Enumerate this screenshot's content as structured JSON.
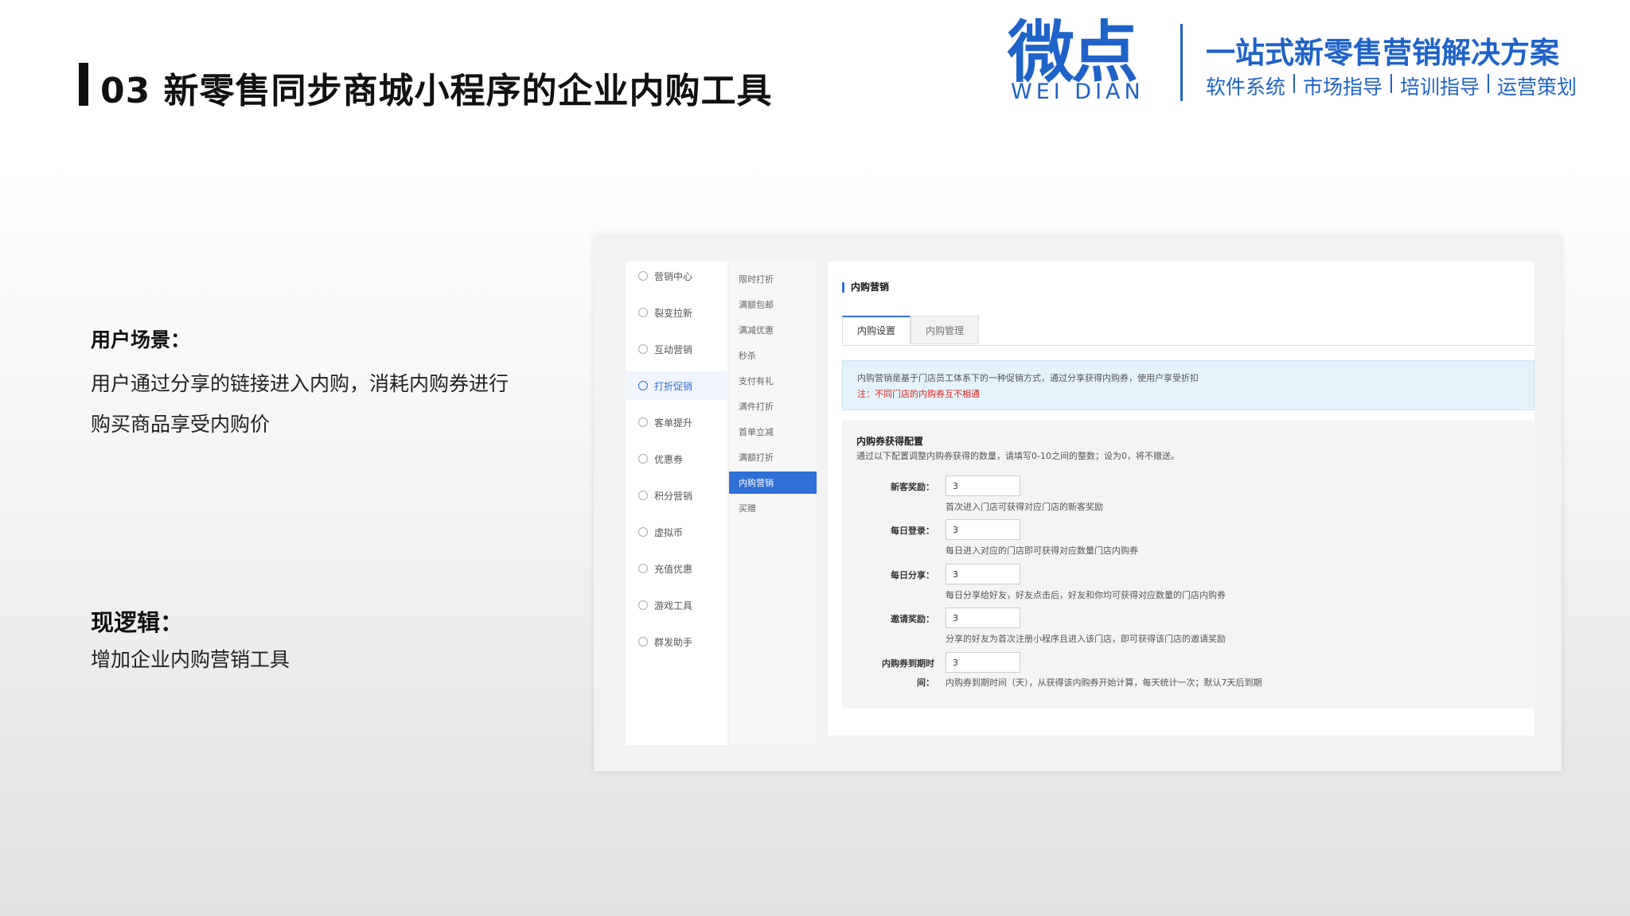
{
  "header": {
    "title": "03 新零售同步商城小程序的企业内购工具",
    "logo_cn": "微点",
    "logo_en": "WEI DIAN",
    "slogan": "一站式新零售营销解决方案",
    "tags": [
      "软件系统",
      "市场指导",
      "培训指导",
      "运营策划"
    ],
    "brand_color": "#1f63c9"
  },
  "left": {
    "scenario_title": "用户场景：",
    "scenario_text": "用户通过分享的链接进入内购，消耗内购券进行购买商品享受内购价",
    "logic_title": "现逻辑：",
    "logic_text": "增加企业内购营销工具"
  },
  "app": {
    "nav": [
      {
        "label": "营销中心",
        "icon": "grid-icon"
      },
      {
        "label": "裂变拉新",
        "icon": "fission-icon"
      },
      {
        "label": "互动营销",
        "icon": "send-icon"
      },
      {
        "label": "打折促销",
        "icon": "discount-icon",
        "active": true
      },
      {
        "label": "客单提升",
        "icon": "search-icon"
      },
      {
        "label": "优惠券",
        "icon": "coupon-icon"
      },
      {
        "label": "积分营销",
        "icon": "points-icon"
      },
      {
        "label": "虚拟币",
        "icon": "coin-icon"
      },
      {
        "label": "充值优惠",
        "icon": "recharge-icon"
      },
      {
        "label": "游戏工具",
        "icon": "game-icon"
      },
      {
        "label": "群发助手",
        "icon": "message-icon"
      }
    ],
    "subnav": [
      "限时打折",
      "满额包邮",
      "满减优惠",
      "秒杀",
      "支付有礼",
      "满件打折",
      "首单立减",
      "满额打折",
      "内购营销",
      "买赠"
    ],
    "subnav_active": "内购营销",
    "main_title": "内购营销",
    "tabs": [
      "内购设置",
      "内购管理"
    ],
    "notice": "内购营销是基于门店员工体系下的一种促销方式，通过分享获得内购券，使用户享受折扣",
    "notice_warn": "注：不同门店的内购券互不相通",
    "form_title": "内购券获得配置",
    "form_desc": "通过以下配置调整内购券获得的数量，请填写0-10之间的整数；设为0，将不赠送。",
    "rows": [
      {
        "label": "新客奖励：",
        "value": "3",
        "hint": "首次进入门店可获得对应门店的新客奖励"
      },
      {
        "label": "每日登录：",
        "value": "3",
        "hint": "每日进入对应的门店即可获得对应数量门店内购券"
      },
      {
        "label": "每日分享：",
        "value": "3",
        "hint": "每日分享给好友，好友点击后，好友和你均可获得对应数量的门店内购券"
      },
      {
        "label": "邀请奖励：",
        "value": "3",
        "hint": "分享的好友为首次注册小程序且进入该门店，即可获得该门店的邀请奖励"
      },
      {
        "label": "内购券到期时",
        "label2": "间：",
        "value": "3",
        "hint": "内购券到期时间（天），从获得该内购券开始计算，每天统计一次；默认7天后到期"
      }
    ],
    "accent_color": "#2f6fd6",
    "warn_color": "#e02020"
  }
}
